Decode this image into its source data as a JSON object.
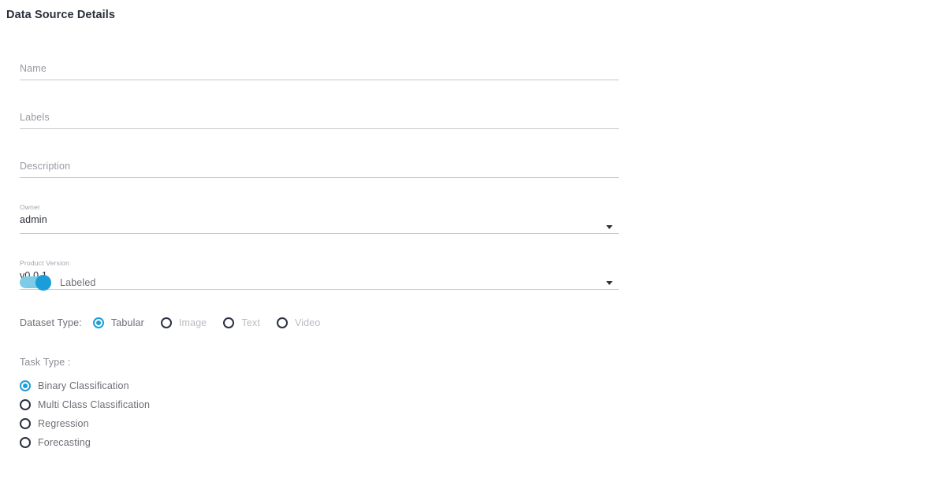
{
  "page": {
    "title": "Data Source Details"
  },
  "form": {
    "fields": [
      {
        "name": "name",
        "placeholder": "Name",
        "value": "",
        "type": "text"
      },
      {
        "name": "labels",
        "placeholder": "Labels",
        "value": "",
        "type": "text"
      },
      {
        "name": "description",
        "placeholder": "Description",
        "value": "",
        "type": "text"
      },
      {
        "name": "owner",
        "label": "Owner",
        "value": "admin",
        "type": "select"
      },
      {
        "name": "product-version",
        "label": "Product Version",
        "value": "v0.0.1",
        "type": "select"
      }
    ]
  },
  "toggle": {
    "label": "Labeled",
    "checked": true
  },
  "dataset_type": {
    "group_label": "Dataset Type:",
    "selected": "Tabular",
    "options": [
      {
        "label": "Tabular",
        "checked": true,
        "disabled": false
      },
      {
        "label": "Image",
        "checked": false,
        "disabled": true
      },
      {
        "label": "Text",
        "checked": false,
        "disabled": true
      },
      {
        "label": "Video",
        "checked": false,
        "disabled": true
      }
    ]
  },
  "task_type": {
    "group_label": "Task Type :",
    "selected": "Binary Classification",
    "options": [
      {
        "label": "Binary Classification",
        "checked": true
      },
      {
        "label": "Multi Class Classification",
        "checked": false
      },
      {
        "label": "Regression",
        "checked": false
      },
      {
        "label": "Forecasting",
        "checked": false
      }
    ]
  },
  "colors": {
    "accent": "#1a9fd9",
    "toggle_track": "#7ecbe7",
    "text_dark": "#2b2f3a",
    "text_muted": "#6f6c76",
    "text_disabled": "#bdbac2",
    "underline": "#c9c9c9"
  }
}
